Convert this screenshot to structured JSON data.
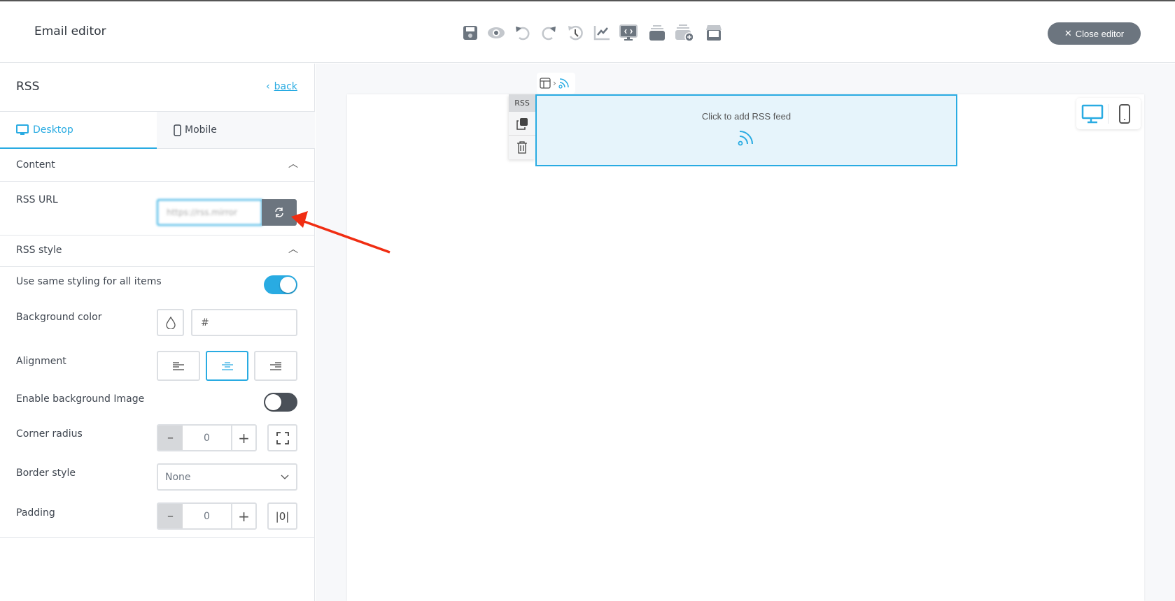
{
  "header": {
    "title": "Email editor",
    "close_label": "Close editor",
    "toolbar_icons": [
      "save-icon",
      "preview-icon",
      "undo-icon",
      "redo-icon",
      "history-icon",
      "analytics-icon",
      "code-view-icon",
      "template-stack-icon",
      "add-template-icon",
      "store-icon"
    ]
  },
  "panel": {
    "title": "RSS",
    "back_label": "back",
    "tabs": [
      {
        "label": "Desktop",
        "active": true
      },
      {
        "label": "Mobile",
        "active": false
      }
    ],
    "content_section": "Content",
    "rss_url_label": "RSS URL",
    "rss_url_value": "https://rss.mirror",
    "style_section": "RSS style",
    "same_styling_label": "Use same styling for all items",
    "same_styling_on": true,
    "bg_color_label": "Background color",
    "bg_color_value": "#",
    "alignment_label": "Alignment",
    "alignment_selected": "center",
    "bg_image_label": "Enable background Image",
    "bg_image_on": false,
    "corner_radius_label": "Corner radius",
    "corner_radius_value": "0",
    "border_style_label": "Border style",
    "border_style_value": "None",
    "padding_label": "Padding",
    "padding_value": "0"
  },
  "canvas": {
    "block_tag": "RSS",
    "placeholder": "Click to add RSS feed"
  },
  "colors": {
    "accent": "#29abe2",
    "block_bg": "#e6f4fb",
    "annotation_arrow": "#f02d12",
    "toggle_off": "#4a5058"
  }
}
